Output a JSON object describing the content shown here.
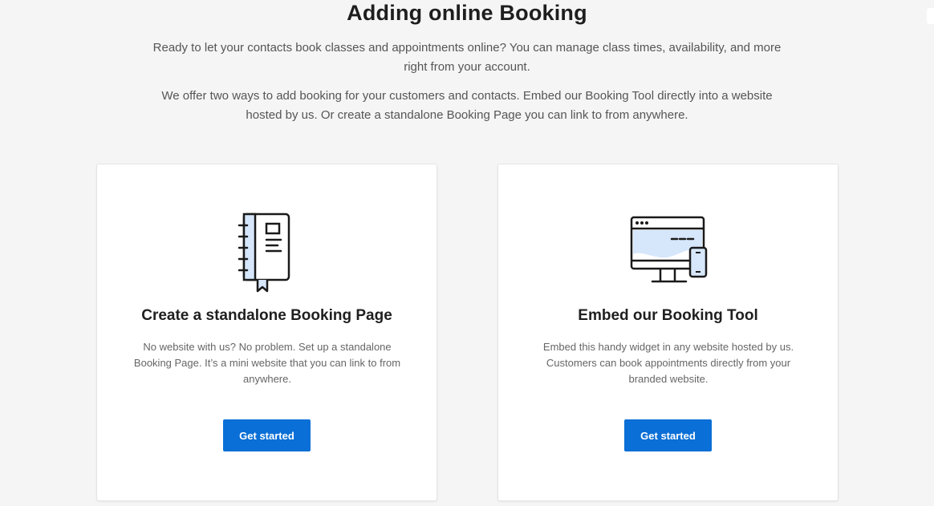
{
  "page": {
    "title": "Adding online Booking",
    "intro_1": "Ready to let your contacts book classes and appointments online? You can manage class times, availability, and more right from your account.",
    "intro_2": "We offer two ways to add booking for your customers and contacts. Embed our Booking Tool directly into a website hosted by us. Or create a standalone Booking Page you can link to from anywhere."
  },
  "cards": [
    {
      "icon": "notebook-icon",
      "title": "Create a standalone Booking Page",
      "description": "No website with us? No problem. Set up a standalone Booking Page. It’s a mini website that you can link to from anywhere.",
      "button_label": "Get started"
    },
    {
      "icon": "website-devices-icon",
      "title": "Embed our Booking Tool",
      "description": "Embed this handy widget in any website hosted by us. Customers can book appointments directly from your branded website.",
      "button_label": "Get started"
    }
  ],
  "colors": {
    "accent": "#0a6fd6",
    "illustration_fill": "#d6e6fb",
    "background": "#f5f5f5"
  }
}
